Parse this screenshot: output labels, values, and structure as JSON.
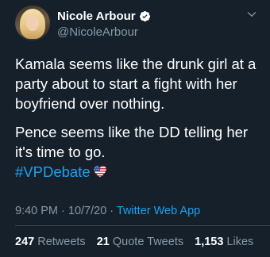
{
  "author": {
    "display_name": "Nicole Arbour",
    "handle": "@NicoleArbour",
    "verified": true
  },
  "tweet": {
    "paragraph_1": "Kamala seems like the drunk girl at a party about to start a fight with her boyfriend over nothing.",
    "paragraph_2": "Pence seems like the DD telling her it's time to go.",
    "hashtag": "#VPDebate",
    "emoji": "heart-flag-emoji"
  },
  "meta": {
    "time": "9:40 PM",
    "separator": " · ",
    "date": "10/7/20",
    "source": "Twitter Web App"
  },
  "stats": {
    "retweets_count": "247",
    "retweets_label": "Retweets",
    "quote_count": "21",
    "quote_label": "Quote Tweets",
    "likes_count": "1,153",
    "likes_label": "Likes"
  },
  "colors": {
    "background": "#15202b",
    "accent": "#1da1f2",
    "secondary_text": "#8899a6",
    "divider": "#38444d"
  }
}
